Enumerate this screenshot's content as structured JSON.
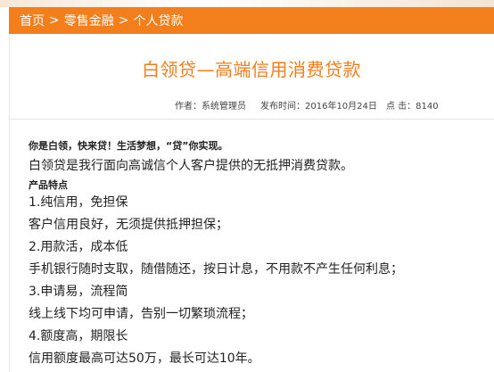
{
  "breadcrumb": {
    "items": [
      "首页",
      "零售金融",
      "个人贷款"
    ],
    "separator": ">"
  },
  "article": {
    "title": "白领贷—高端信用消费贷款",
    "meta": {
      "author": "作者：系统管理员",
      "published": "发布时间：2016年10月24日",
      "clicks": "点 击：8140"
    },
    "paragraphs": [
      "你是白领，快来贷！生活梦想，“贷”你实现。",
      "白领贷是我行面向高诚信个人客户提供的无抵押消费贷款。",
      "产品特点",
      "1.纯信用，免担保",
      "客户信用良好，无须提供抵押担保；",
      "2.用款活，成本低",
      "手机银行随时支取，随借随还，按日计息，不用款不产生任何利息；",
      "3.申请易，流程简",
      "线上线下均可申请，告别一切繁琐流程；",
      "4.额度高，期限长",
      "信用额度最高可达50万，最长可达10年。"
    ]
  },
  "colors": {
    "accent": "#f27e1c",
    "text": "#222222"
  }
}
